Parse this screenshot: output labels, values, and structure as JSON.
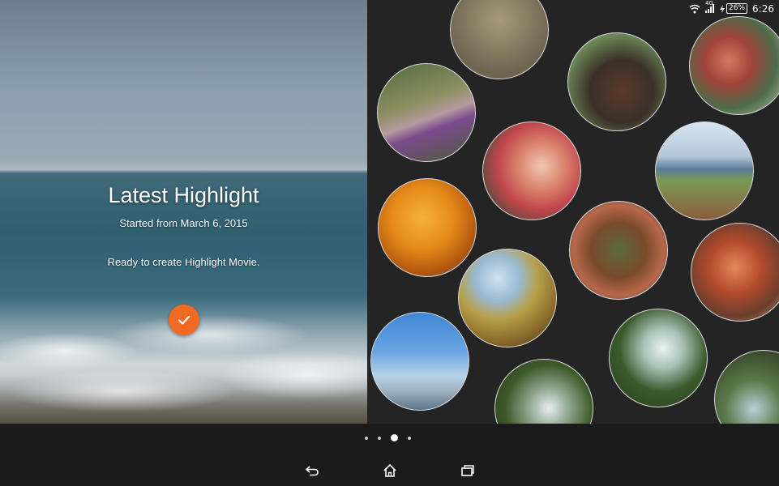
{
  "hero": {
    "title": "Latest Highlight",
    "subtitle": "Started from March 6, 2015",
    "message": "Ready to create Highlight Movie."
  },
  "status_bar": {
    "network": "4G",
    "battery": "26%",
    "time": "6:26"
  },
  "pager": {
    "count": 4,
    "active_index": 2
  },
  "colors": {
    "accent": "#f26a21",
    "background": "#1b1b1b"
  },
  "icons": [
    "wifi-icon",
    "signal-icon",
    "battery-icon",
    "check-icon",
    "back-icon",
    "home-icon",
    "recent-apps-icon"
  ]
}
